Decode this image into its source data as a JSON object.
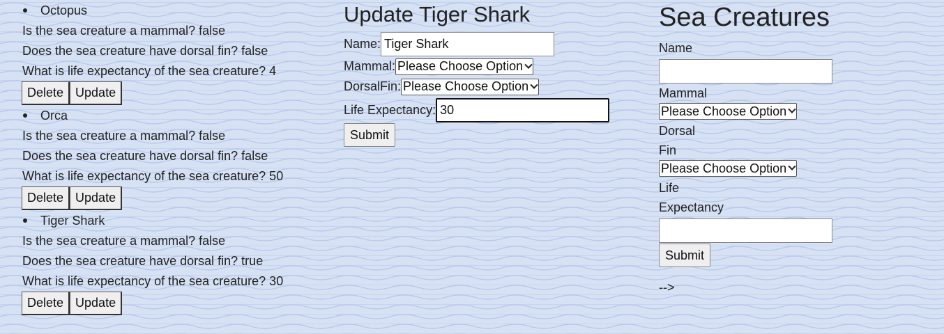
{
  "creatures": [
    {
      "name": "Octopus",
      "mammal_line": "Is the sea creature a mammal? false",
      "fin_line": "Does the sea creature have dorsal fin? false",
      "life_line": "What is life expectancy of the sea creature? 4",
      "delete_label": "Delete",
      "update_label": "Update"
    },
    {
      "name": "Orca",
      "mammal_line": "Is the sea creature a mammal? false",
      "fin_line": "Does the sea creature have dorsal fin? false",
      "life_line": "What is life expectancy of the sea creature? 50",
      "delete_label": "Delete",
      "update_label": "Update"
    },
    {
      "name": "Tiger Shark",
      "mammal_line": "Is the sea creature a mammal? false",
      "fin_line": "Does the sea creature have dorsal fin? true",
      "life_line": "What is life expectancy of the sea creature? 30",
      "delete_label": "Delete",
      "update_label": "Update"
    }
  ],
  "update_form": {
    "title": "Update Tiger Shark",
    "name_label": "Name:",
    "name_value": "Tiger Shark",
    "mammal_label": "Mammal:",
    "mammal_selected": "Please Choose Option",
    "fin_label": "DorsalFin:",
    "fin_selected": "Please Choose Option",
    "life_label": "Life Expectancy:",
    "life_value": "30",
    "submit_label": "Submit"
  },
  "create_form": {
    "title": "Sea Creatures",
    "name_label": "Name",
    "name_value": "",
    "mammal_label": "Mammal",
    "mammal_selected": "Please Choose Option",
    "fin_label_1": "Dorsal",
    "fin_label_2": "Fin",
    "fin_selected": "Please Choose Option",
    "life_label_1": "Life",
    "life_label_2": "Expectancy",
    "life_value": "",
    "submit_label": "Submit",
    "stray_text": "-->"
  }
}
